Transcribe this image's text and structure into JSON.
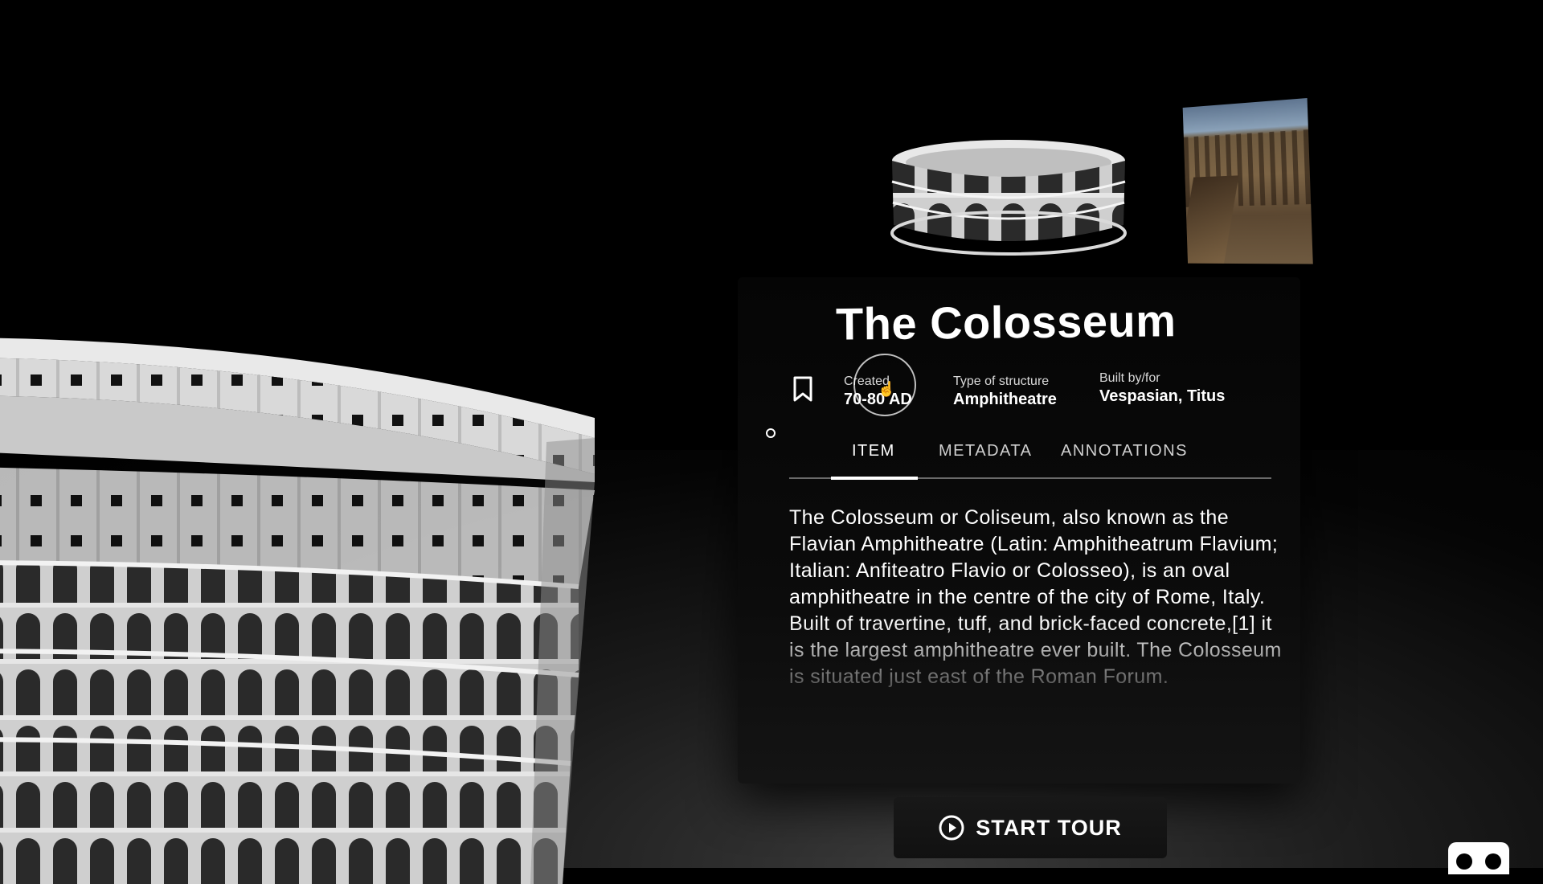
{
  "item": {
    "title": "The Colosseum",
    "meta": [
      {
        "label": "Created",
        "value": "70-80 AD"
      },
      {
        "label": "Type of structure",
        "value": "Amphitheatre"
      },
      {
        "label": "Built by/for",
        "value": "Vespasian, Titus"
      }
    ],
    "description": "The Colosseum or Coliseum, also known as the Flavian Amphitheatre (Latin: Amphitheatrum Flavium; Italian: Anfiteatro Flavio or Colosseo), is an oval amphitheatre in the centre of the city of Rome, Italy. Built of travertine, tuff, and brick-faced concrete,[1] it is the largest amphitheatre ever built. The Colosseum is situated just east of the Roman Forum."
  },
  "tabs": [
    {
      "label": "ITEM",
      "active": true
    },
    {
      "label": "METADATA",
      "active": false
    },
    {
      "label": "ANNOTATIONS",
      "active": false
    }
  ],
  "actions": {
    "start_tour_label": "START TOUR"
  },
  "icons": {
    "bookmark": "bookmark-icon",
    "play": "play-circle-icon",
    "vr": "vr-headset-icon"
  },
  "colors": {
    "background": "#000000",
    "panel": "#0b0b0b",
    "text": "#ffffff",
    "divider": "#6a6a6a"
  }
}
